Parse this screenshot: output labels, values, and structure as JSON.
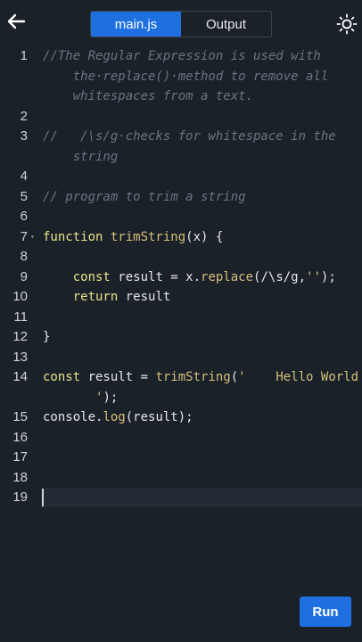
{
  "header": {
    "tabs": [
      {
        "label": "main.js",
        "active": true
      },
      {
        "label": "Output",
        "active": false
      }
    ],
    "back_icon": "arrow-left-icon",
    "theme_icon": "sun-icon"
  },
  "editor": {
    "lines": [
      {
        "num": "1",
        "segments": [
          {
            "t": "//The Regular Expression is used with",
            "c": "comment"
          }
        ]
      },
      {
        "num": "",
        "segments": [
          {
            "t": "    the·replace()·method to remove all",
            "c": "comment"
          }
        ]
      },
      {
        "num": "",
        "segments": [
          {
            "t": "    whitespaces from a text.",
            "c": "comment"
          }
        ]
      },
      {
        "num": "2",
        "segments": []
      },
      {
        "num": "3",
        "segments": [
          {
            "t": "//   /\\s/g·checks for whitespace in the",
            "c": "comment"
          }
        ]
      },
      {
        "num": "",
        "segments": [
          {
            "t": "    string",
            "c": "comment"
          }
        ]
      },
      {
        "num": "4",
        "segments": []
      },
      {
        "num": "5",
        "segments": [
          {
            "t": "// program to trim a string",
            "c": "comment"
          }
        ]
      },
      {
        "num": "6",
        "segments": []
      },
      {
        "num": "7",
        "segments": [
          {
            "t": "function ",
            "c": "kw"
          },
          {
            "t": "trimString",
            "c": "fn"
          },
          {
            "t": "(x) {",
            "c": ""
          }
        ]
      },
      {
        "num": "8",
        "segments": []
      },
      {
        "num": "9",
        "segments": [
          {
            "t": "    const ",
            "c": "kw"
          },
          {
            "t": "result = x.",
            "c": ""
          },
          {
            "t": "replace",
            "c": "fn"
          },
          {
            "t": "(/\\s/g,",
            "c": ""
          },
          {
            "t": "''",
            "c": "str"
          },
          {
            "t": ");",
            "c": ""
          }
        ]
      },
      {
        "num": "10",
        "segments": [
          {
            "t": "    return ",
            "c": "kw"
          },
          {
            "t": "result",
            "c": ""
          }
        ]
      },
      {
        "num": "11",
        "segments": []
      },
      {
        "num": "12",
        "segments": [
          {
            "t": "}",
            "c": ""
          }
        ]
      },
      {
        "num": "13",
        "segments": []
      },
      {
        "num": "14",
        "segments": [
          {
            "t": "const ",
            "c": "kw"
          },
          {
            "t": "result = ",
            "c": ""
          },
          {
            "t": "trimString",
            "c": "fn"
          },
          {
            "t": "(",
            "c": ""
          },
          {
            "t": "'    Hello World",
            "c": "str"
          }
        ]
      },
      {
        "num": "",
        "segments": [
          {
            "t": "       '",
            "c": "str"
          },
          {
            "t": ");",
            "c": ""
          }
        ]
      },
      {
        "num": "15",
        "segments": [
          {
            "t": "console.",
            "c": ""
          },
          {
            "t": "log",
            "c": "fn"
          },
          {
            "t": "(result);",
            "c": ""
          }
        ]
      },
      {
        "num": "16",
        "segments": []
      },
      {
        "num": "17",
        "segments": []
      },
      {
        "num": "18",
        "segments": []
      },
      {
        "num": "19",
        "segments": [],
        "active": true
      }
    ]
  },
  "footer": {
    "run_label": "Run"
  },
  "colors": {
    "accent": "#1e6fe0",
    "background": "#1b2129"
  }
}
